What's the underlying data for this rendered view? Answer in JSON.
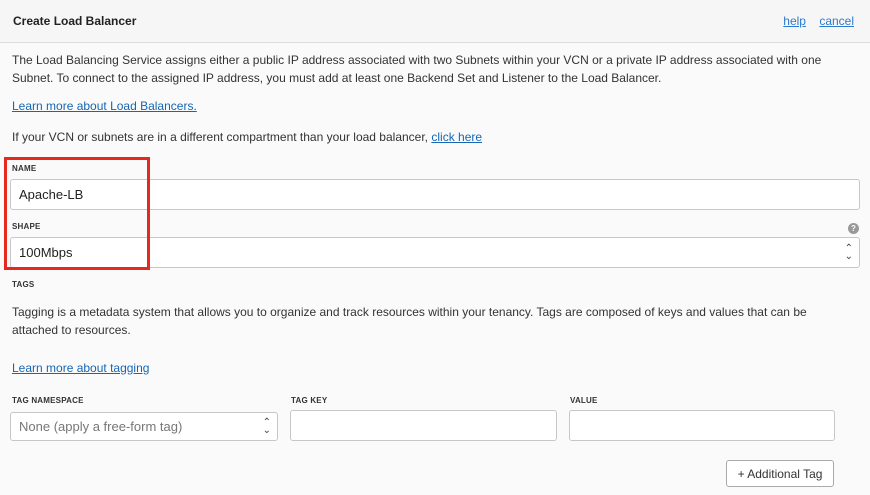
{
  "header": {
    "title": "Create Load Balancer",
    "help_label": "help",
    "cancel_label": "cancel"
  },
  "intro": {
    "description": "The Load Balancing Service assigns either a public IP address associated with two Subnets within your VCN or a private IP address associated with one Subnet. To connect to the assigned IP address, you must add at least one Backend Set and Listener to the Load Balancer.",
    "learn_more": "Learn more about Load Balancers.",
    "compartment_text": "If your VCN or subnets are in a different compartment than your load balancer,",
    "compartment_link": "click here"
  },
  "name_field": {
    "label": "NAME",
    "value": "Apache-LB"
  },
  "shape_field": {
    "label": "SHAPE",
    "value": "100Mbps",
    "help_icon": "?"
  },
  "tags": {
    "heading": "TAGS",
    "description": "Tagging is a metadata system that allows you to organize and track resources within your tenancy. Tags are composed of keys and values that can be attached to resources.",
    "learn_more": "Learn more about tagging",
    "namespace_label": "TAG NAMESPACE",
    "namespace_placeholder": "None (apply a free-form tag)",
    "key_label": "TAG KEY",
    "key_value": "",
    "value_label": "VALUE",
    "value_value": "",
    "add_button": "+ Additional Tag"
  },
  "colors": {
    "link": "#1566b4",
    "highlight_box": "#e5291f",
    "header_bg": "#f6f6f6"
  }
}
